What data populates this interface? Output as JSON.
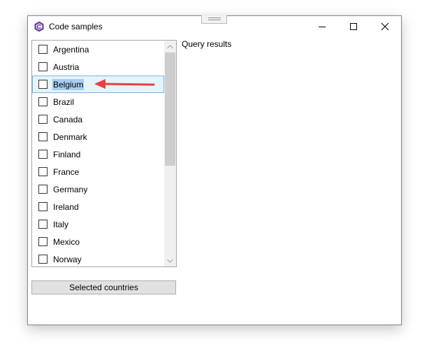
{
  "window": {
    "title": "Code samples",
    "app_icon": "csharp-hexagon-icon",
    "controls": {
      "minimize_icon": "minimize-icon",
      "maximize_icon": "maximize-icon",
      "close_icon": "close-icon"
    }
  },
  "country_list": {
    "items": [
      {
        "label": "Argentina",
        "checked": false
      },
      {
        "label": "Austria",
        "checked": false
      },
      {
        "label": "Belgium",
        "checked": false,
        "selected": true
      },
      {
        "label": "Brazil",
        "checked": false
      },
      {
        "label": "Canada",
        "checked": false
      },
      {
        "label": "Denmark",
        "checked": false
      },
      {
        "label": "Finland",
        "checked": false
      },
      {
        "label": "France",
        "checked": false
      },
      {
        "label": "Germany",
        "checked": false
      },
      {
        "label": "Ireland",
        "checked": false
      },
      {
        "label": "Italy",
        "checked": false
      },
      {
        "label": "Mexico",
        "checked": false
      },
      {
        "label": "Norway",
        "checked": false
      }
    ],
    "scroll_up_icon": "chevron-up-icon",
    "scroll_down_icon": "chevron-down-icon"
  },
  "query_results": {
    "label": "Query results"
  },
  "actions": {
    "selected_countries_label": "Selected countries"
  },
  "annotation": {
    "icon": "red-arrow-icon",
    "color": "#e8413c"
  },
  "colors": {
    "app_icon": "#6a3fa0",
    "selection_border": "#7eb4ea",
    "selection_fill": "#e5f3fb",
    "text_highlight": "#a8cef2",
    "button_fill": "#e1e1e1"
  }
}
